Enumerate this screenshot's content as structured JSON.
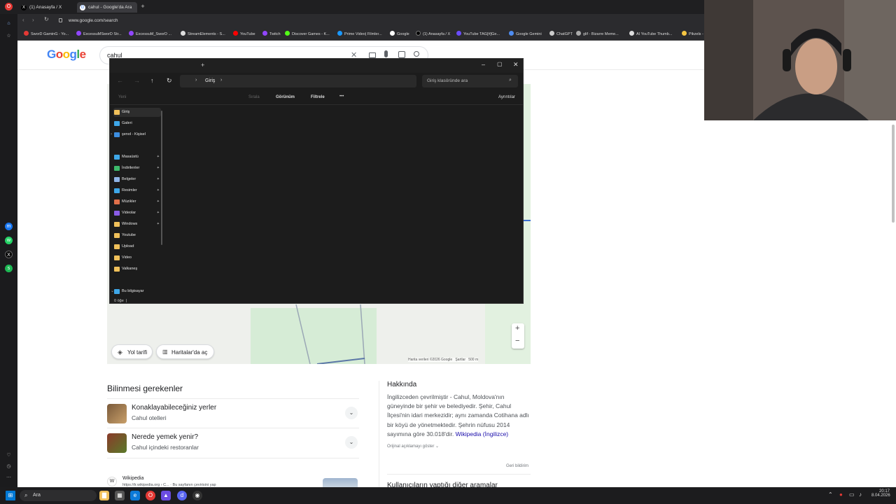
{
  "browser": {
    "tabs": [
      {
        "title": "(1) Anasayfa / X"
      },
      {
        "title": "cahul - Google'da Ara"
      }
    ],
    "new_tab": "+",
    "url": "www.google.com/search",
    "bookmarks": [
      "SworD GaminG - Yo...",
      "ExcessuMSworD Str...",
      "ExcessuM_SworD ...",
      "StreamElements - S...",
      "YouTube",
      "Twitch",
      "Discover Games - K...",
      "Prime Video| Filmler...",
      "Google",
      "(1) Anasayfa / X",
      "YouTube TAG[#]Ge...",
      "Google Gemini",
      "ChatGPT",
      "glif - Bizarre Meme...",
      "AI YouTube Thumb...",
      "Pikzels -"
    ]
  },
  "google": {
    "logo": "Google",
    "query": "cahul",
    "map_buttons": {
      "directions": "Yol tarifi",
      "open_maps": "Haritalar'da aç"
    },
    "map_footer": {
      "data": "Harita verileri ©2026 Google",
      "terms": "Şartlar",
      "scale": "500 m"
    },
    "zoom_in": "+",
    "zoom_out": "−",
    "know_title": "Bilinmesi gerekenler",
    "items": [
      {
        "title": "Konaklayabileceğiniz yerler",
        "sub": "Cahul otelleri"
      },
      {
        "title": "Nerede yemek yenir?",
        "sub": "Cahul içindeki restoranlar"
      }
    ],
    "about_title": "Hakkında",
    "about_text": "İngilizceden çevrilmiştir - Cahul, Moldova'nın güneyinde bir şehir ve belediyedir. Şehir, Cahul İlçesi'nin idari merkezidir; aynı zamanda Cotihana adlı bir köyü de yönetmektedir. Şehrin nüfusu 2014 sayımına göre 30.018'dir.",
    "about_link": "Wikipedia (İngilizce)",
    "show_original": "Orijinal açıklamayı göster",
    "feedback": "Geri bildirim",
    "wiki_source": "Wikipedia",
    "wiki_url": "https://tr.wikipedia.org › C... · Bu sayfanın çevirisini yap",
    "others_title": "Kullanıcıların yaptığı diğer aramalar"
  },
  "explorer": {
    "breadcrumb": "Giriş",
    "search_placeholder": "Giriş klasöründe ara",
    "new": "Yeni",
    "sort": "Sırala",
    "view": "Görünüm",
    "filter": "Filtrele",
    "more": "•••",
    "details": "Ayrıntılar",
    "nav": [
      {
        "label": "Giriş",
        "color": "#f0c05a",
        "pin": false
      },
      {
        "label": "Galeri",
        "color": "#3ea7e8",
        "pin": false
      },
      {
        "label": "şenol - Kişisel",
        "color": "#3d8ee0",
        "pin": false
      },
      {
        "label": "Masaüstü",
        "color": "#3ea7e8",
        "pin": true
      },
      {
        "label": "İndirilenler",
        "color": "#3dba6b",
        "pin": true
      },
      {
        "label": "Belgeler",
        "color": "#8fb4e6",
        "pin": true
      },
      {
        "label": "Resimler",
        "color": "#3ea7e8",
        "pin": true
      },
      {
        "label": "Müzikler",
        "color": "#e0704a",
        "pin": true
      },
      {
        "label": "Videolar",
        "color": "#8a5ce6",
        "pin": true
      },
      {
        "label": "Windows",
        "color": "#f0c05a",
        "pin": true
      },
      {
        "label": "Youtube",
        "color": "#f0c05a",
        "pin": false
      },
      {
        "label": "Upload",
        "color": "#f0c05a",
        "pin": false
      },
      {
        "label": "Video",
        "color": "#f0c05a",
        "pin": false
      },
      {
        "label": "Valkaneş",
        "color": "#f0c05a",
        "pin": false
      },
      {
        "label": "Bu bilgisayar",
        "color": "#3ea7e8",
        "pin": false
      }
    ],
    "status": "0 öğe"
  },
  "taskbar": {
    "search": "Ara",
    "time": "20:17",
    "date": "8.04.2026"
  }
}
